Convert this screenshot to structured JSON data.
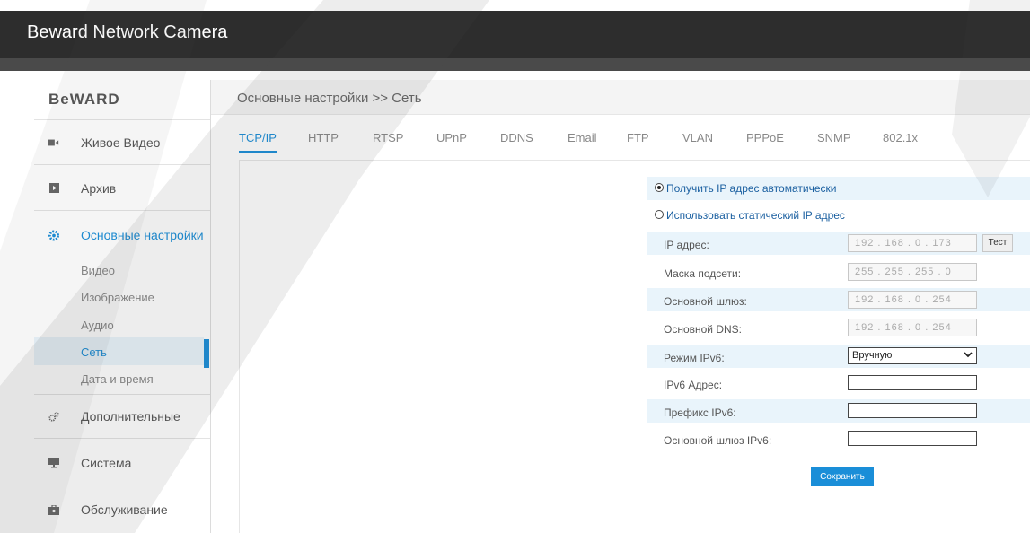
{
  "header": {
    "title": "Beward Network Camera"
  },
  "sidebar": {
    "logo": "BeWARD",
    "items": [
      {
        "label": "Живое Видео",
        "icon": "video-camera-icon"
      },
      {
        "label": "Архив",
        "icon": "play-icon"
      },
      {
        "label": "Основные настройки",
        "icon": "gear-icon"
      },
      {
        "label": "Дополнительные",
        "icon": "gears-icon"
      },
      {
        "label": "Система",
        "icon": "monitor-icon"
      },
      {
        "label": "Обслуживание",
        "icon": "toolbox-icon"
      }
    ],
    "sub_items": [
      "Видео",
      "Изображение",
      "Аудио",
      "Сеть",
      "Дата и время"
    ]
  },
  "content": {
    "breadcrumb": "Основные настройки >> Сеть",
    "tabs": [
      "TCP/IP",
      "HTTP",
      "RTSP",
      "UPnP",
      "DDNS",
      "Email",
      "FTP",
      "VLAN",
      "PPPoE",
      "SNMP",
      "802.1x"
    ],
    "active_tab": "TCP/IP"
  },
  "form": {
    "radio_auto": "Получить IP адрес автоматически",
    "radio_static": "Использовать статический IP адрес",
    "ip_label": "IP адрес:",
    "ip_value": "192 . 168 .  0  . 173",
    "test_label": "Тест",
    "mask_label": "Маска подсети:",
    "mask_value": "255 . 255 . 255 .  0",
    "gateway_label": "Основной шлюз:",
    "gateway_value": "192 . 168 .  0  . 254",
    "dns_label": "Основной DNS:",
    "dns_value": "192 . 168 .  0  . 254",
    "ipv6_mode_label": "Режим IPv6:",
    "ipv6_mode_value": "Вручную",
    "ipv6_addr_label": "IPv6 Адрес:",
    "ipv6_prefix_label": "Префикс IPv6:",
    "ipv6_gateway_label": "Основной шлюз IPv6:",
    "save_label": "Сохранить"
  },
  "colors": {
    "accent": "#1a8ed8",
    "header_bg": "#2d2d2d",
    "row_highlight": "#e9f4fb"
  }
}
